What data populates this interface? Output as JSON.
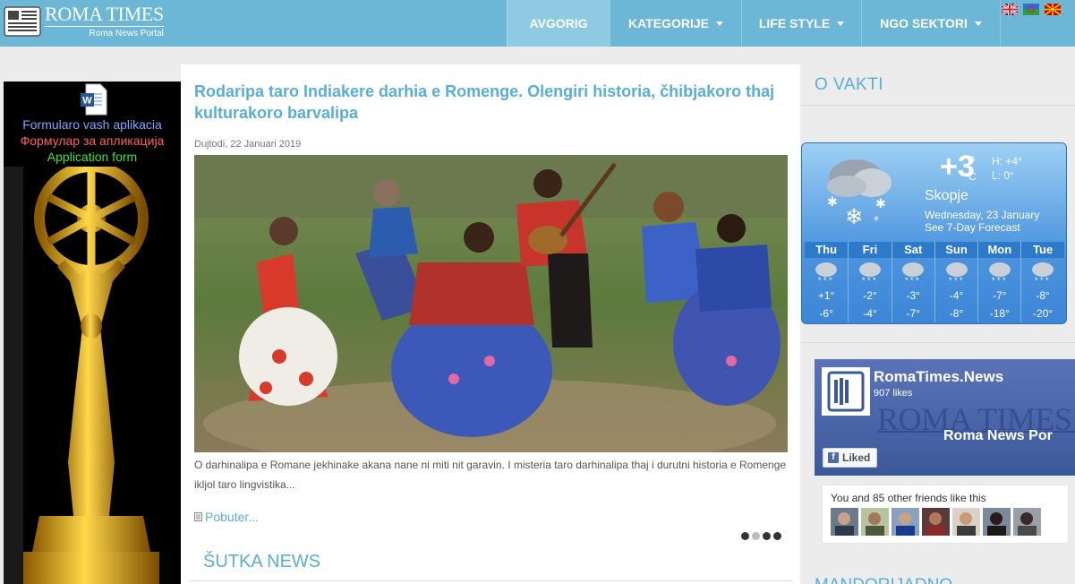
{
  "header": {
    "logo_title": "ROMA TIMES",
    "logo_subtitle": "Roma News Portal",
    "nav": [
      {
        "label": "AVGORIG",
        "active": true,
        "dropdown": false
      },
      {
        "label": "KATEGORIJE",
        "active": false,
        "dropdown": true
      },
      {
        "label": "LIFE STYLE",
        "active": false,
        "dropdown": true
      },
      {
        "label": "NGO SEKTORI",
        "active": false,
        "dropdown": true
      }
    ],
    "flags": [
      "uk-flag-icon",
      "romani-flag-icon",
      "macedonia-flag-icon"
    ],
    "brand_color": "#6db7d6"
  },
  "banner": {
    "line1": "Formularo vash aplikacia",
    "line2": "Формулар за апликација",
    "line3": "Application form"
  },
  "article": {
    "title": "Rodaripa taro Indiakere darhia e Romenge. Olengiri historia, čhibjakoro thaj kulturakoro barvalipa",
    "date": "Dujtodi, 22 Januari 2019",
    "excerpt": "O darhinalipa e Romane jekhinake akana nane ni miti nit garavin. I misteria taro darhinalipa thaj i durutni historia e Romenge ikljol taro lingvistika...",
    "read_more": "Pobuter...",
    "slider_dots": 4,
    "slider_active_index": 1
  },
  "sections": {
    "sutka": "ŠUTKA NEWS"
  },
  "sidebar": {
    "vakti_title": "O VAKTI",
    "next_title": "MANDORIJADNO"
  },
  "weather": {
    "temp": "+3",
    "unit_deg": "o",
    "unit_c": "C",
    "high": "H: +4°",
    "low": "L: 0°",
    "city": "Skopje",
    "date": "Wednesday, 23 January",
    "forecast_link": "See 7-Day Forecast",
    "days": [
      {
        "name": "Thu",
        "hi": "+1°",
        "lo": "-6°"
      },
      {
        "name": "Fri",
        "hi": "-2°",
        "lo": "-4°"
      },
      {
        "name": "Sat",
        "hi": "-3°",
        "lo": "-7°"
      },
      {
        "name": "Sun",
        "hi": "-4°",
        "lo": "-8°"
      },
      {
        "name": "Mon",
        "hi": "-7°",
        "lo": "-18°"
      },
      {
        "name": "Tue",
        "hi": "-8°",
        "lo": "-20°"
      }
    ]
  },
  "facebook": {
    "page_name": "RomaTimes.News",
    "likes": "907 likes",
    "cover_text": "ROMA TIMES",
    "cover_subtitle": "Roma News Por",
    "liked_button": "Liked",
    "friends_text": "You and 85 other friends like this",
    "faces": 7
  }
}
